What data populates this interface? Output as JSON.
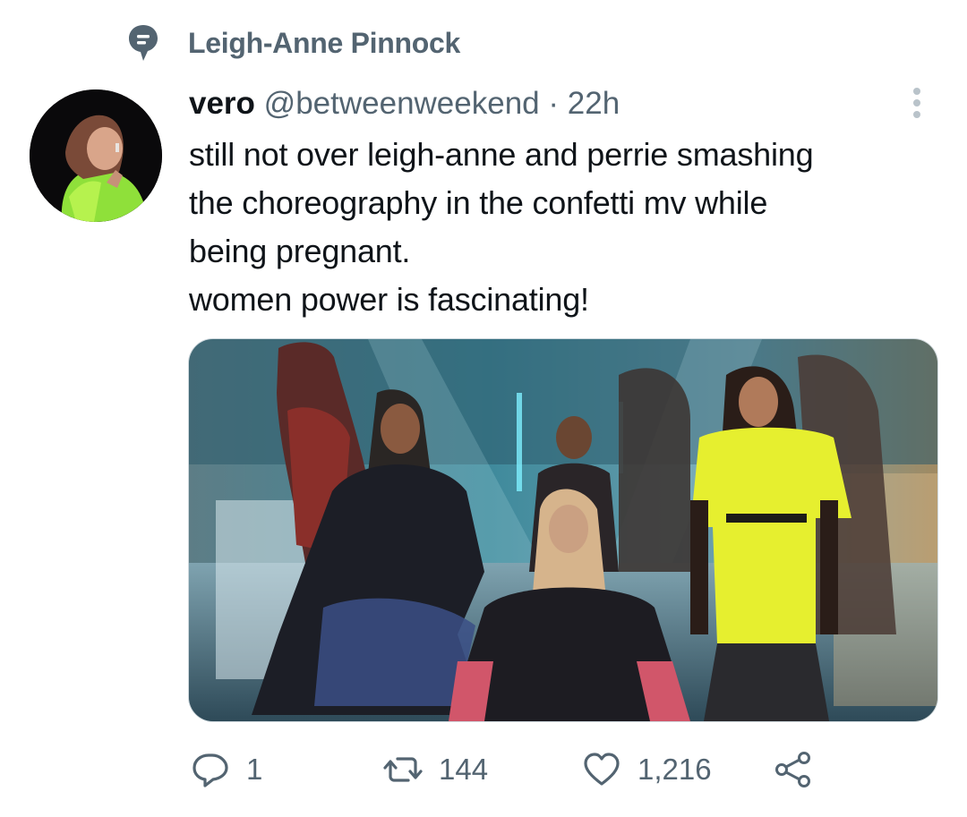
{
  "topic": {
    "label": "Leigh-Anne Pinnock",
    "icon": "topic-bubble-icon"
  },
  "tweet": {
    "display_name": "vero",
    "handle": "@betweenweekend",
    "separator": "·",
    "time": "22h",
    "lines": [
      "still not over leigh-anne and perrie smashing",
      "the choreography in the confetti mv while",
      "being pregnant.",
      "women power is fascinating!"
    ]
  },
  "actions": {
    "reply_count": "1",
    "retweet_count": "144",
    "like_count": "1,216"
  },
  "icons": {
    "topic": "topic-bubble-icon",
    "more": "more-vertical-icon",
    "reply": "reply-icon",
    "retweet": "retweet-icon",
    "like": "heart-icon",
    "share": "share-icon"
  },
  "colors": {
    "text": "#0f1419",
    "secondary": "#536471",
    "border": "#cfd9de"
  }
}
